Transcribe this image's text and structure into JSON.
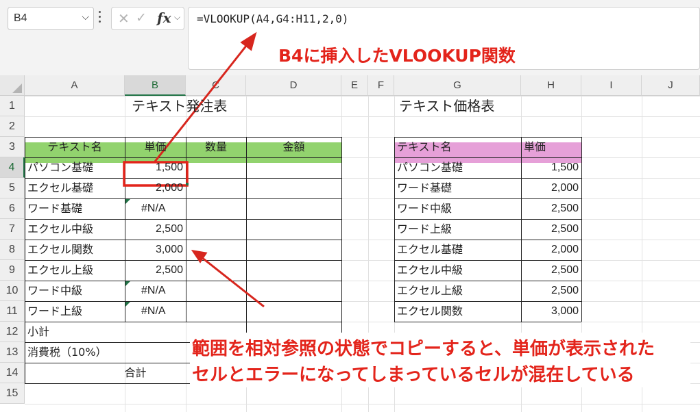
{
  "name_box": {
    "value": "B4"
  },
  "formula_bar": {
    "formula": "=VLOOKUP(A4,G4:H11,2,0)"
  },
  "columns": [
    "A",
    "B",
    "C",
    "D",
    "E",
    "F",
    "G",
    "H",
    "I",
    "J"
  ],
  "rows": [
    "1",
    "2",
    "3",
    "4",
    "5",
    "6",
    "7",
    "8",
    "9",
    "10",
    "11",
    "12",
    "13",
    "14",
    "15"
  ],
  "order_table": {
    "title": "テキスト発注表",
    "headers": [
      "テキスト名",
      "単価",
      "数量",
      "金額"
    ],
    "rows": [
      {
        "name": "パソコン基礎",
        "price": "1,500"
      },
      {
        "name": "エクセル基礎",
        "price": "2,000"
      },
      {
        "name": "ワード基礎",
        "price": "#N/A"
      },
      {
        "name": "エクセル中級",
        "price": "2,500"
      },
      {
        "name": "エクセル関数",
        "price": "3,000"
      },
      {
        "name": "エクセル上級",
        "price": "2,500"
      },
      {
        "name": "ワード中級",
        "price": "#N/A"
      },
      {
        "name": "ワード上級",
        "price": "#N/A"
      }
    ],
    "subtotal_label": "小計",
    "tax_label": "消費税（10%）",
    "total_label": "合計"
  },
  "price_table": {
    "title": "テキスト価格表",
    "headers": [
      "テキスト名",
      "単価"
    ],
    "rows": [
      {
        "name": "パソコン基礎",
        "price": "1,500"
      },
      {
        "name": "ワード基礎",
        "price": "2,000"
      },
      {
        "name": "ワード中級",
        "price": "2,500"
      },
      {
        "name": "ワード上級",
        "price": "2,500"
      },
      {
        "name": "エクセル基礎",
        "price": "2,000"
      },
      {
        "name": "エクセル中級",
        "price": "2,500"
      },
      {
        "name": "エクセル上級",
        "price": "2,500"
      },
      {
        "name": "エクセル関数",
        "price": "3,000"
      }
    ]
  },
  "annotations": {
    "top": "B4に挿入したVLOOKUP関数",
    "bottom_line1": "範囲を相対参照の状態でコピーすると、単価が表示された",
    "bottom_line2": "セルとエラーになってしまっているセルが混在している"
  },
  "colors": {
    "order_header": "#92d36e",
    "price_header": "#e6a0d8",
    "annotation": "#e3241b",
    "selection": "#217346"
  }
}
